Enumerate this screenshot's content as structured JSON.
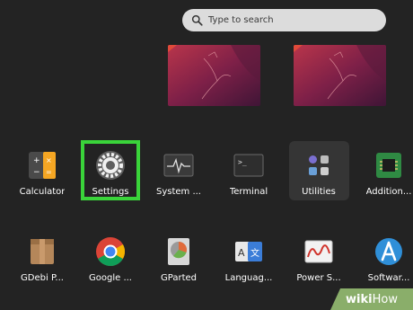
{
  "search": {
    "placeholder": "Type to search",
    "icon": "search-icon"
  },
  "workspaces": [
    {
      "name": "workspace-thumbnail-1"
    },
    {
      "name": "workspace-thumbnail-2"
    }
  ],
  "apps_row1": [
    {
      "label": "Calculator",
      "icon": "calculator-icon"
    },
    {
      "label": "Settings",
      "icon": "settings-gear-icon",
      "highlighted": true
    },
    {
      "label": "System ...",
      "icon": "system-monitor-icon"
    },
    {
      "label": "Terminal",
      "icon": "terminal-icon"
    },
    {
      "label": "Utilities",
      "icon": "utilities-folder-icon"
    },
    {
      "label": "Addition...",
      "icon": "additional-drivers-icon"
    }
  ],
  "apps_row2": [
    {
      "label": "GDebi P...",
      "icon": "gdebi-package-icon"
    },
    {
      "label": "Google ...",
      "icon": "google-chrome-icon"
    },
    {
      "label": "GParted",
      "icon": "gparted-disk-icon"
    },
    {
      "label": "Languag...",
      "icon": "language-support-icon"
    },
    {
      "label": "Power S...",
      "icon": "power-statistics-icon"
    },
    {
      "label": "Softwar...",
      "icon": "software-updater-icon"
    }
  ],
  "watermark": {
    "brand_wiki": "wiki",
    "brand_how": "How"
  },
  "colors": {
    "highlight": "#3ad43a",
    "background": "#232323"
  }
}
